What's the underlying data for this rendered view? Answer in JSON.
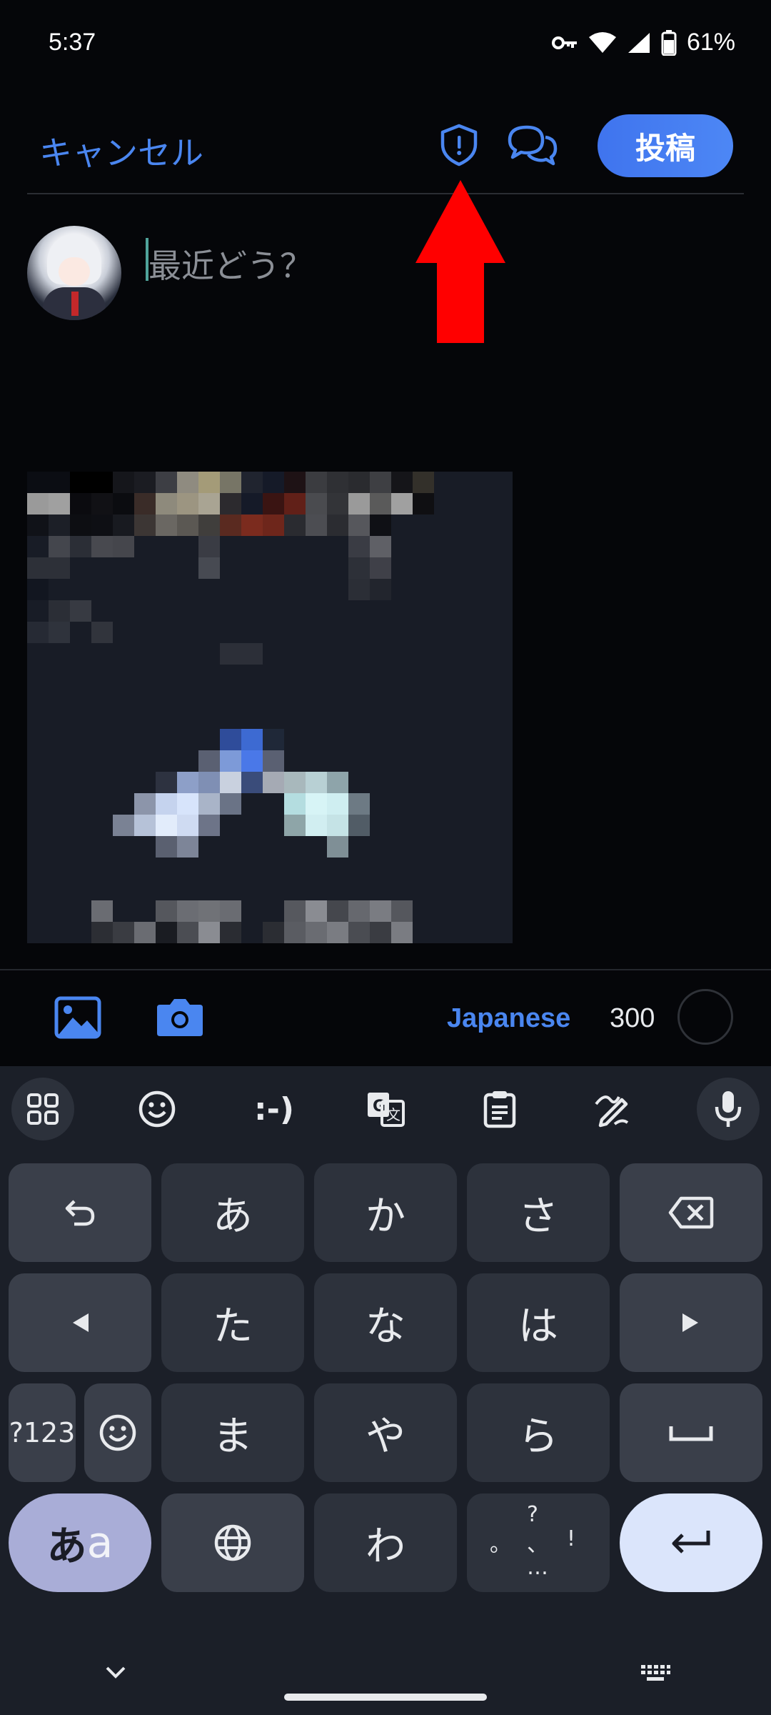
{
  "status": {
    "time": "5:37",
    "battery_pct": "61%"
  },
  "header": {
    "cancel_label": "キャンセル",
    "post_label": "投稿",
    "shield_icon": "shield-alert-icon",
    "chat_icon": "conversation-icon"
  },
  "compose": {
    "placeholder": "最近どう？"
  },
  "toolbar": {
    "language": "Japanese",
    "char_count": "300"
  },
  "keyboard": {
    "top_row": [
      "apps-grid-icon",
      "emoji-icon",
      ":-)",
      "translate-icon",
      "clipboard-icon",
      "handwriting-icon",
      "mic-icon"
    ],
    "emoticon_label": ":-)",
    "row1": [
      "あ",
      "か",
      "さ"
    ],
    "row2": [
      "た",
      "な",
      "は"
    ],
    "row3": [
      "ま",
      "や",
      "ら"
    ],
    "row4": [
      "わ"
    ],
    "num_label": "?123",
    "aa_label_main": "あ",
    "aa_label_alt": "a",
    "punct": [
      "?",
      "。",
      "、",
      "!",
      "…"
    ]
  },
  "colors": {
    "accent": "#4a86f0",
    "background": "#050609",
    "keyboard_bg": "#1b1f28",
    "arrow": "#ff0000"
  }
}
